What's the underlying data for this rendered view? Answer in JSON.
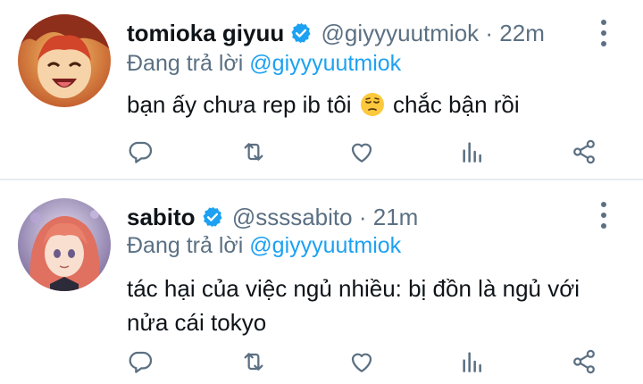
{
  "tweets": [
    {
      "name": "tomioka giyuu",
      "handle": "@giyyyuutmiok",
      "separator": "·",
      "time": "22m",
      "replying_prefix": "Đang trả lời ",
      "replying_to": "@giyyyuutmiok",
      "text_before_emoji": "bạn ấy chưa rep ib tôi ",
      "emoji": "pensive-face",
      "text_after_emoji": " chắc bận rồi",
      "avatar": "smiling-anime-character-avatar"
    },
    {
      "name": "sabito",
      "handle": "@ssssabito",
      "separator": "·",
      "time": "21m",
      "replying_prefix": "Đang trả lời ",
      "replying_to": "@giyyyuutmiok",
      "text": "tác hại của việc ngủ nhiều: bị đồn là ngủ với nửa cái tokyo",
      "avatar": "pink-haired-anime-character-avatar"
    }
  ],
  "icons": {
    "reply": "reply-icon",
    "retweet": "retweet-icon",
    "like": "heart-icon",
    "stats": "stats-icon",
    "share": "share-icon",
    "more": "more-options-icon",
    "verified": "verified-badge-icon"
  },
  "colors": {
    "accent": "#1da1f2",
    "secondary_text": "#5b7083",
    "primary_text": "#0f1419",
    "divider": "#e6ecf0"
  }
}
